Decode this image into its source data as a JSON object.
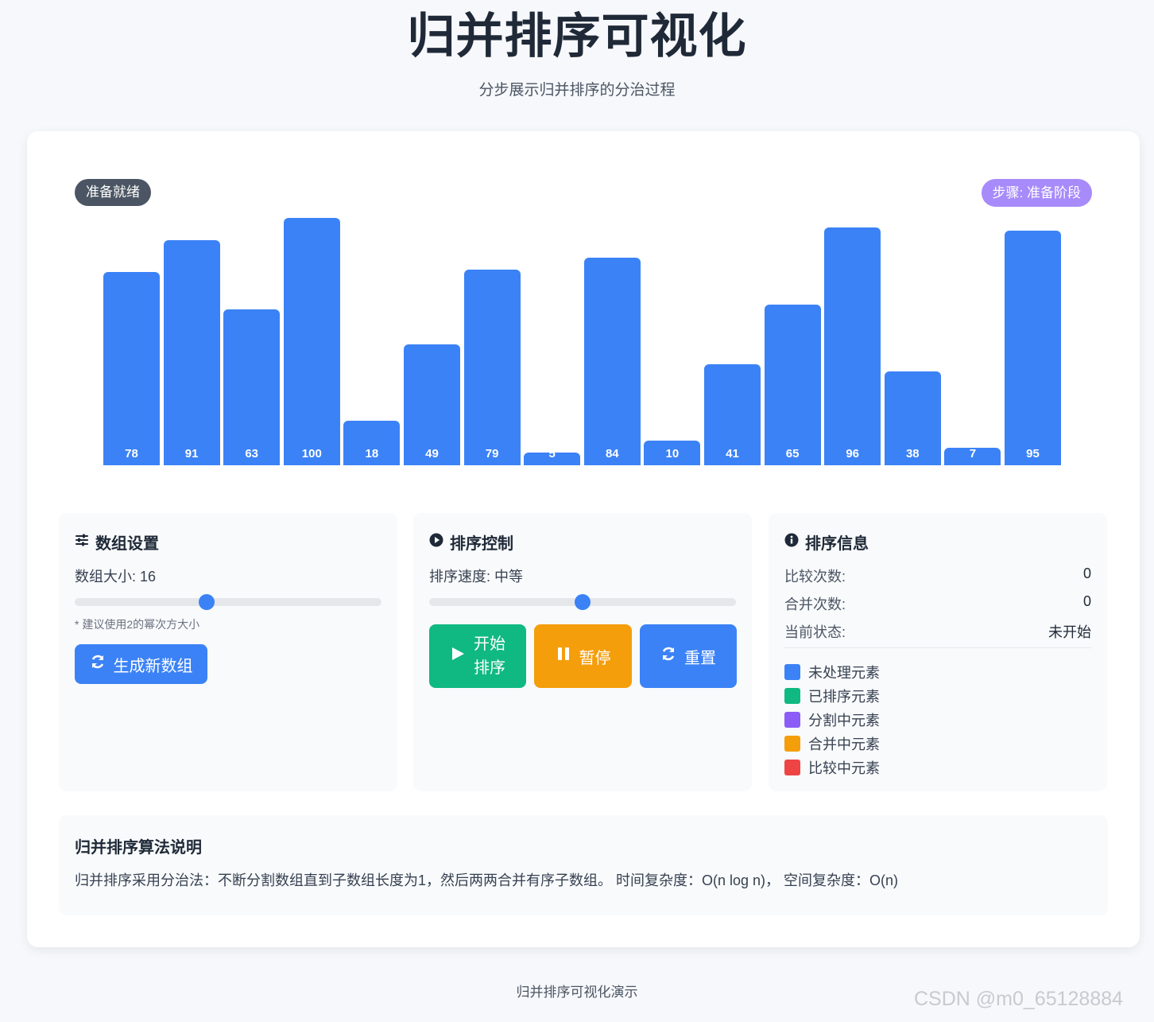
{
  "header": {
    "title": "归并排序可视化",
    "subtitle": "分步展示归并排序的分治过程"
  },
  "status": {
    "badge": "准备就绪",
    "step": "步骤: 准备阶段"
  },
  "chart_data": {
    "type": "bar",
    "values": [
      78,
      91,
      63,
      100,
      18,
      49,
      79,
      5,
      84,
      10,
      41,
      65,
      96,
      38,
      7,
      95
    ],
    "ylim": [
      0,
      100
    ],
    "bar_color": "#3b82f6"
  },
  "array_settings": {
    "title": "数组设置",
    "size_label": "数组大小: 16",
    "size_value": 16,
    "size_slider_fraction": 0.43,
    "hint": "* 建议使用2的幂次方大小",
    "generate_button": "生成新数组"
  },
  "sort_control": {
    "title": "排序控制",
    "speed_label": "排序速度: 中等",
    "speed_slider_fraction": 0.5,
    "start_button_line1": "开始",
    "start_button_line2": "排序",
    "pause_button": "暂停",
    "reset_button": "重置"
  },
  "sort_info": {
    "title": "排序信息",
    "rows": [
      {
        "label": "比较次数:",
        "value": "0"
      },
      {
        "label": "合并次数:",
        "value": "0"
      },
      {
        "label": "当前状态:",
        "value": "未开始"
      }
    ],
    "legend": [
      {
        "label": "未处理元素",
        "color": "#3b82f6"
      },
      {
        "label": "已排序元素",
        "color": "#10b981"
      },
      {
        "label": "分割中元素",
        "color": "#8b5cf6"
      },
      {
        "label": "合并中元素",
        "color": "#f59e0b"
      },
      {
        "label": "比较中元素",
        "color": "#ef4444"
      }
    ]
  },
  "algorithm": {
    "title": "归并排序算法说明",
    "description": "归并排序采用分治法：不断分割数组直到子数组长度为1，然后两两合并有序子数组。 时间复杂度：O(n log n)， 空间复杂度：O(n)"
  },
  "footer": "归并排序可视化演示",
  "watermark": "CSDN @m0_65128884"
}
